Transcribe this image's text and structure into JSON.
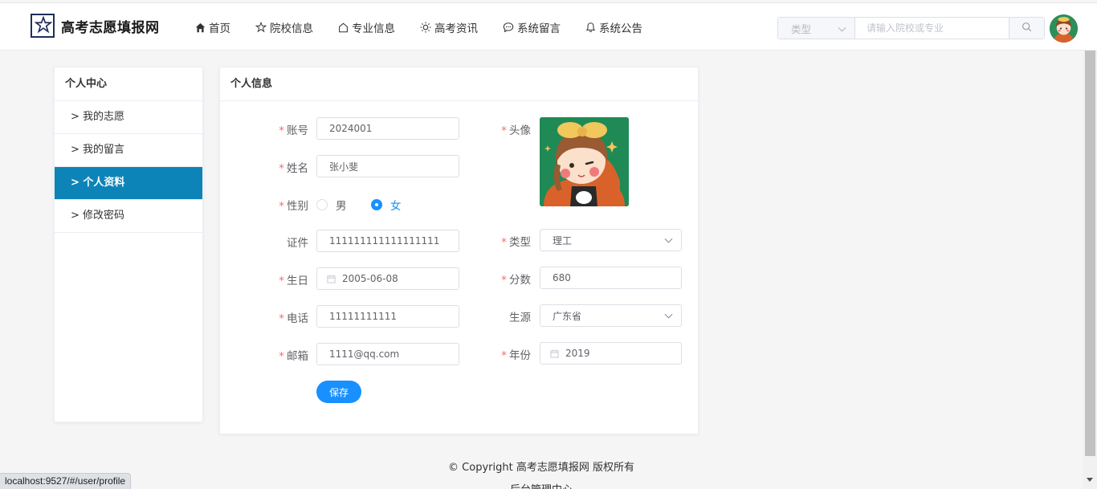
{
  "site": {
    "title": "高考志愿填报网"
  },
  "nav": [
    {
      "label": "首页",
      "icon": "home-icon"
    },
    {
      "label": "院校信息",
      "icon": "star-icon"
    },
    {
      "label": "专业信息",
      "icon": "house-outline-icon"
    },
    {
      "label": "高考资讯",
      "icon": "sun-icon"
    },
    {
      "label": "系统留言",
      "icon": "chat-icon"
    },
    {
      "label": "系统公告",
      "icon": "bell-icon"
    }
  ],
  "search": {
    "type_placeholder": "类型",
    "placeholder": "请输入院校或专业"
  },
  "sidebar": {
    "title": "个人中心",
    "items": [
      {
        "label": "> 我的志愿"
      },
      {
        "label": "> 我的留言"
      },
      {
        "label": "> 个人资料",
        "active": true
      },
      {
        "label": "> 修改密码"
      }
    ]
  },
  "panel": {
    "title": "个人信息"
  },
  "form": {
    "account_label": "账号",
    "account": "2024001",
    "name_label": "姓名",
    "name": "张小斐",
    "gender_label": "性别",
    "gender_male": "男",
    "gender_female": "女",
    "gender_selected": "女",
    "avatar_label": "头像",
    "id_label": "证件",
    "id": "111111111111111111",
    "type_label": "类型",
    "type": "理工",
    "birthday_label": "生日",
    "birthday": "2005-06-08",
    "score_label": "分数",
    "score": "680",
    "phone_label": "电话",
    "phone": "11111111111",
    "origin_label": "生源",
    "origin": "广东省",
    "email_label": "邮箱",
    "email": "1111@qq.com",
    "year_label": "年份",
    "year": "2019",
    "save_label": "保存"
  },
  "footer": {
    "copyright": "© Copyright 高考志愿填报网 版权所有",
    "admin_link": "后台管理中心"
  },
  "status_url": "localhost:9527/#/user/profile",
  "colors": {
    "accent": "#1890ff",
    "sidebar_active": "#0d84b8",
    "required": "#f56c6c"
  }
}
